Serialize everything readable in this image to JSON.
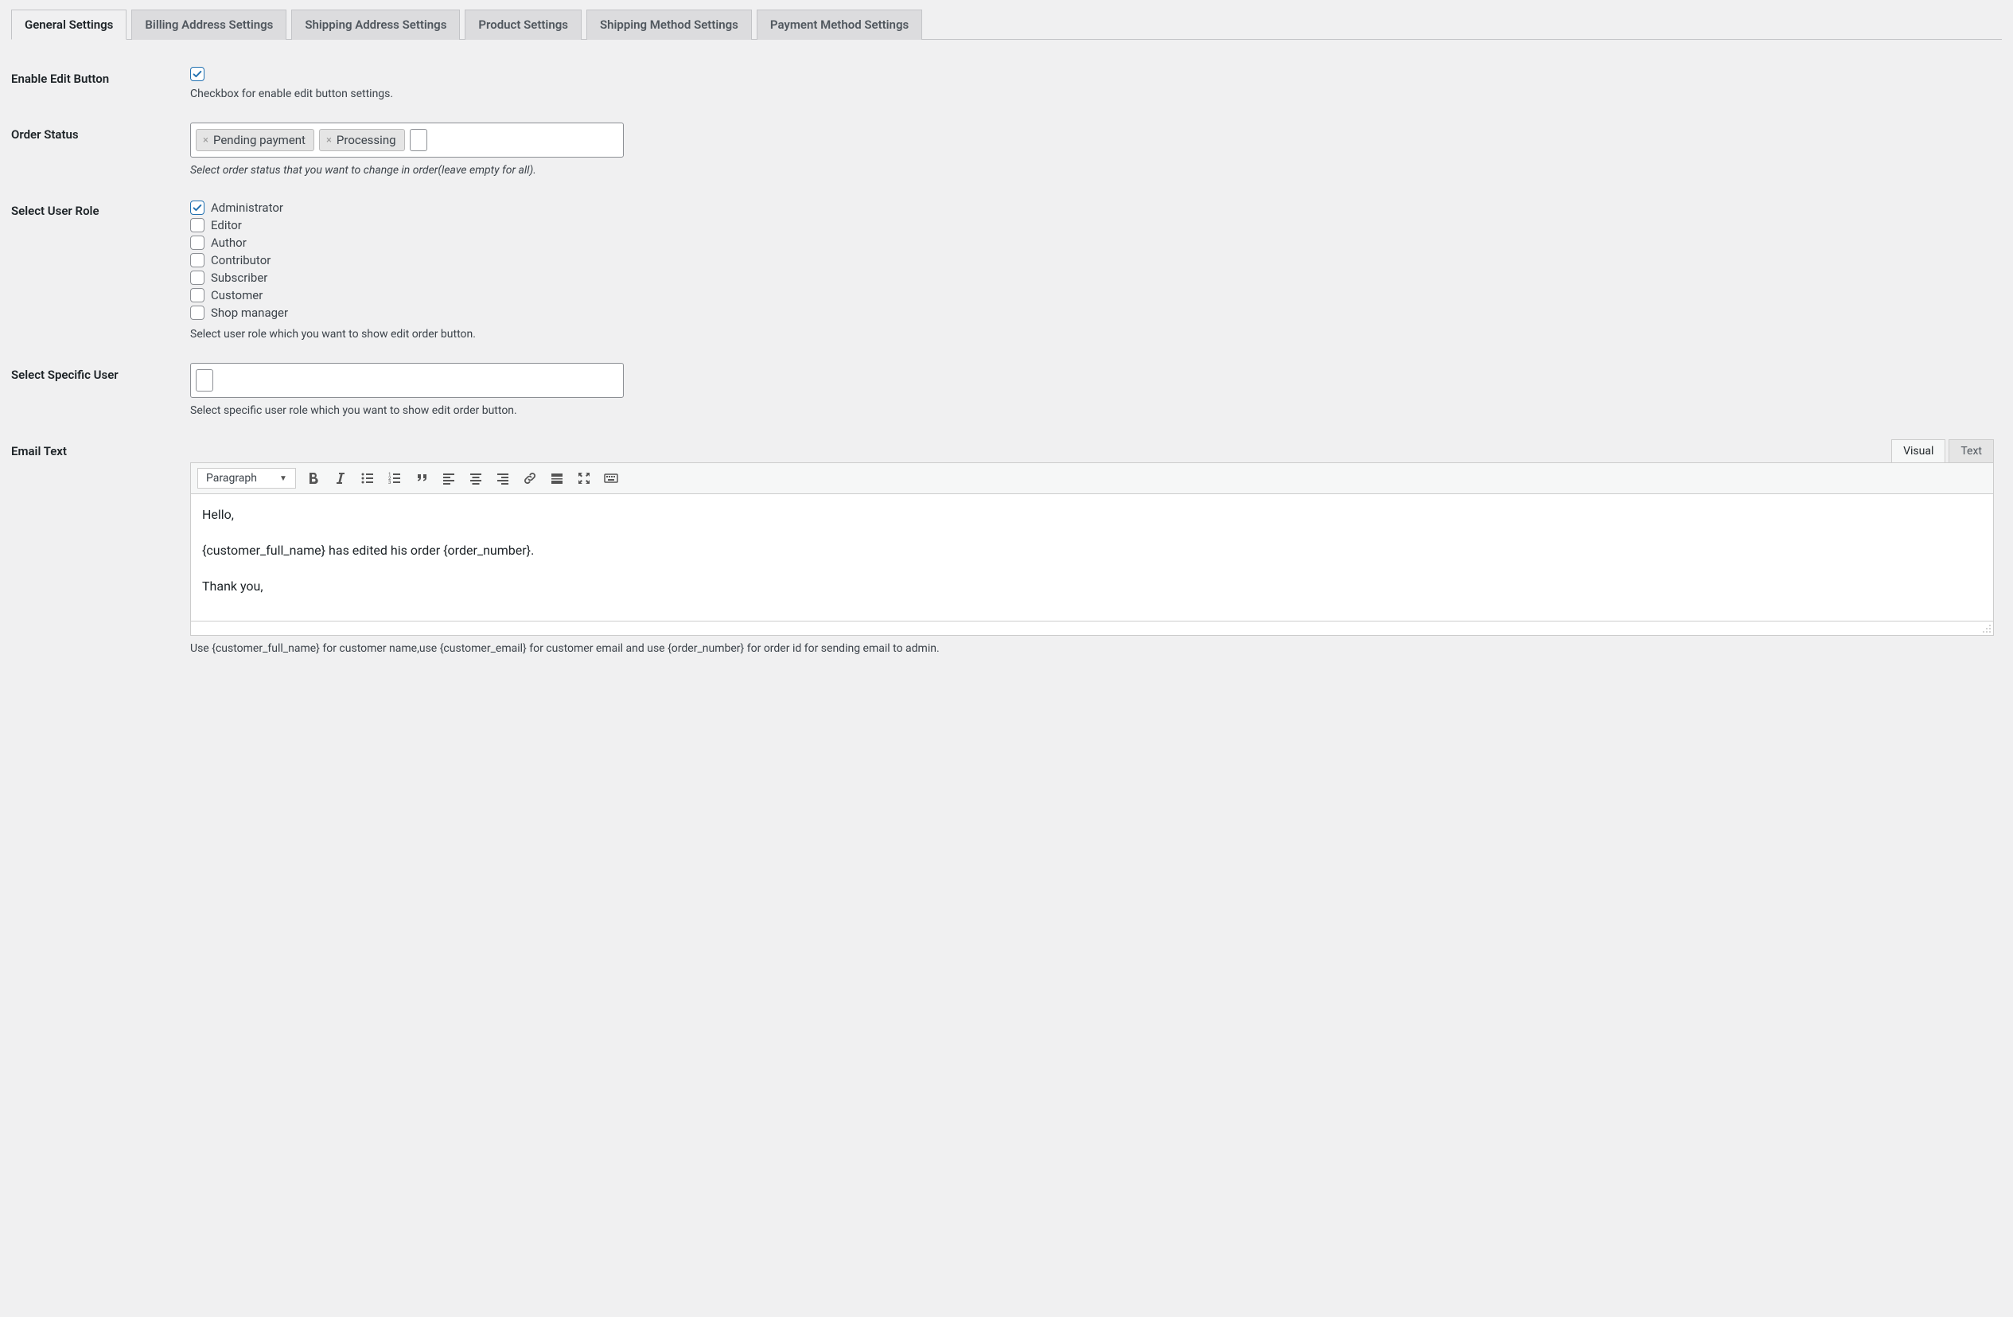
{
  "tabs": [
    {
      "label": "General Settings",
      "active": true
    },
    {
      "label": "Billing Address Settings",
      "active": false
    },
    {
      "label": "Shipping Address Settings",
      "active": false
    },
    {
      "label": "Product Settings",
      "active": false
    },
    {
      "label": "Shipping Method Settings",
      "active": false
    },
    {
      "label": "Payment Method Settings",
      "active": false
    }
  ],
  "fields": {
    "enable_edit": {
      "label": "Enable Edit Button",
      "checked": true,
      "description": "Checkbox for enable edit button settings."
    },
    "order_status": {
      "label": "Order Status",
      "tags": [
        "Pending payment",
        "Processing"
      ],
      "description": "Select order status that you want to change in order(leave empty for all)."
    },
    "user_role": {
      "label": "Select User Role",
      "options": [
        {
          "label": "Administrator",
          "checked": true
        },
        {
          "label": "Editor",
          "checked": false
        },
        {
          "label": "Author",
          "checked": false
        },
        {
          "label": "Contributor",
          "checked": false
        },
        {
          "label": "Subscriber",
          "checked": false
        },
        {
          "label": "Customer",
          "checked": false
        },
        {
          "label": "Shop manager",
          "checked": false
        }
      ],
      "description": "Select user role which you want to show edit order button."
    },
    "specific_user": {
      "label": "Select Specific User",
      "description": "Select specific user role which you want to show edit order button."
    },
    "email_text": {
      "label": "Email Text",
      "editor_tabs": {
        "visual": "Visual",
        "text": "Text"
      },
      "format_select": "Paragraph",
      "body_lines": [
        "Hello,",
        "{customer_full_name} has edited his order {order_number}.",
        "Thank you,"
      ],
      "description": "Use {customer_full_name} for customer name,use {customer_email} for customer email and use {order_number} for order id for sending email to admin."
    }
  }
}
